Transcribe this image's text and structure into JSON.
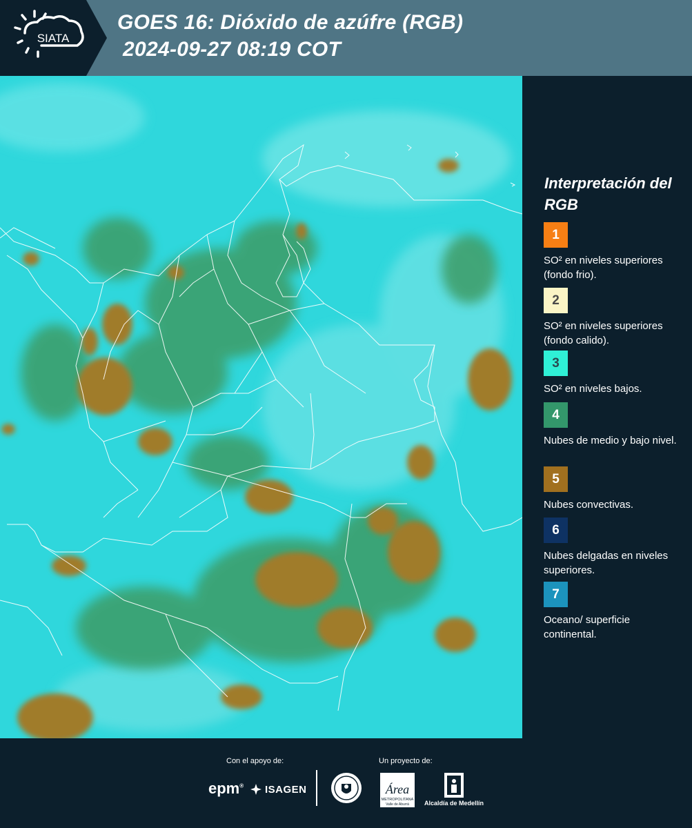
{
  "header": {
    "title_line1": "GOES 16: Dióxido de azúfre (RGB)",
    "title_line2": "2024-09-27 08:19 COT",
    "logo_text": "SIATA"
  },
  "map": {
    "background_color": "#2fd7dc",
    "convective_color": "#a07c2b",
    "mid_low_cloud_color": "#3a9a63",
    "boundary_color": "#ffffff"
  },
  "legend": {
    "title": "Interpretación del RGB",
    "items": [
      {
        "number": "1",
        "color": "#f77f14",
        "text_color": "#ffffff",
        "label": "SO² en niveles superiores (fondo frio)."
      },
      {
        "number": "2",
        "color": "#fbf5c6",
        "text_color": "#4a4a4a",
        "label": "SO² en niveles superiores (fondo calido)."
      },
      {
        "number": "3",
        "color": "#2ff0d6",
        "text_color": "#2a4a50",
        "label": "SO² en niveles bajos."
      },
      {
        "number": "4",
        "color": "#33976b",
        "text_color": "#ffffff",
        "label": "Nubes de medio y bajo nivel."
      },
      {
        "number": "5",
        "color": "#a1701f",
        "text_color": "#ffffff",
        "label": "Nubes convectivas."
      },
      {
        "number": "6",
        "color": "#0e3263",
        "text_color": "#ffffff",
        "label": "Nubes delgadas en niveles superiores."
      },
      {
        "number": "7",
        "color": "#1c93bd",
        "text_color": "#ffffff",
        "label": "Oceano/ superficie continental."
      }
    ]
  },
  "footer": {
    "support_label": "Con el apoyo de:",
    "project_label": "Un proyecto de:",
    "sponsors": [
      "epm",
      "ISAGEN"
    ],
    "area_logo_text": "Área",
    "area_logo_subtext": "METROPOLITANA",
    "area_logo_subtext2": "Valle de Aburrá",
    "alcaldia_text": "Alcaldía de Medellín"
  }
}
